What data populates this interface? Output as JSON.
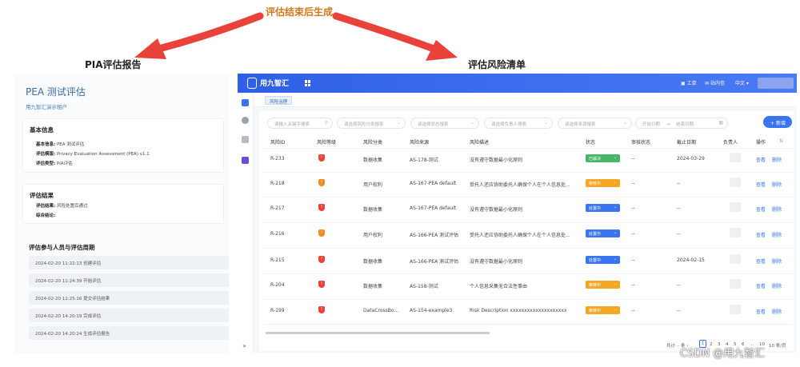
{
  "annotation": {
    "top_label": "评估结束后生成",
    "left_heading": "PIA评估报告",
    "right_heading": "评估风险清单"
  },
  "report": {
    "title": "PEA 测试评估",
    "tenant": "用九智汇演示租户",
    "basic_info": {
      "title": "基本信息",
      "name_label": "基本信息:",
      "name_value": "PEA 测试评估",
      "template_label": "评估模版:",
      "template_value": "Privacy Evaluation Assessment (PEA) v1.1",
      "type_label": "评估类型:",
      "type_value": "PIA评估"
    },
    "result": {
      "title": "评估结果",
      "result_label": "评估结果:",
      "result_value": "风险处置后通过",
      "conclusion_label": "综合结论:",
      "conclusion_value": ""
    },
    "timeline_title": "评估参与人员与评估周期",
    "timeline": [
      "2024-02-20 11:22:13 创建评估",
      "2024-02-20 11:24:39 开始评估",
      "2024-02-20 11:25:16 提交评估结果",
      "2024-02-20 14:20:19 完成评估",
      "2024-02-20 14:20:24 生成评估报告"
    ]
  },
  "app": {
    "logo": "用九智汇",
    "topbar_items": [
      "工单",
      "站内信",
      "中文"
    ],
    "tab": "风险治理",
    "filters": {
      "keyword": "请输入关键字搜索",
      "category": "请选择风险分类搜索",
      "status": "请选择状态搜索",
      "owner": "请选择负责人搜索",
      "source": "请选择来源搜索",
      "start_date": "开始日期",
      "arrow": "→",
      "end_date": "结束日期"
    },
    "add_button": "新增",
    "columns": [
      "风险ID",
      "风险等级",
      "风险分类",
      "风险来源",
      "风险描述",
      "状态",
      "审核状态",
      "截止日期",
      "负责人",
      "操作"
    ],
    "rows": [
      {
        "id": "R-233",
        "category": "数据收集",
        "source": "AS-178-测试",
        "desc": "没有遵守数据最小化原则",
        "status": "已解决",
        "review": "--",
        "due": "2024-03-29"
      },
      {
        "id": "R-218",
        "category": "用户权利",
        "source": "AS-167-PEA default",
        "desc": "受托人还应协助委托人确保个人在个人信息处...",
        "status": "审核中",
        "review": "--",
        "due": "--"
      },
      {
        "id": "R-217",
        "category": "数据收集",
        "source": "AS-167-PEA default",
        "desc": "没有遵守数据最小化原则",
        "status": "处置中",
        "review": "--",
        "due": "--"
      },
      {
        "id": "R-216",
        "category": "用户权利",
        "source": "AS-166-PEA 测试评估",
        "desc": "受托人还应协助委托人确保个人在个人信息处...",
        "status": "处置中",
        "review": "--",
        "due": "--"
      },
      {
        "id": "R-215",
        "category": "数据收集",
        "source": "AS-166-PEA 测试评估",
        "desc": "没有遵守数据最小化原则",
        "status": "处置中",
        "review": "--",
        "due": "2024-02-15"
      },
      {
        "id": "R-204",
        "category": "数据收集",
        "source": "AS-158-测试",
        "desc": "个人信息采集无合法性事由",
        "status": "审核中",
        "review": "--",
        "due": "--"
      },
      {
        "id": "R-199",
        "category": "DataCrossBo...",
        "source": "AS-154-example3",
        "desc": "Risk Description xxxxxxxxxxxxxxxxxxxx",
        "status": "审核中",
        "review": "--",
        "due": "--"
      }
    ],
    "actions": {
      "view": "查看",
      "delete": "删除"
    },
    "pager": {
      "total_prefix": "共计",
      "total_suffix": "条",
      "pages": [
        "1",
        "2",
        "3",
        "4",
        "5",
        "6",
        "...",
        "10"
      ],
      "per_page": "10 条/页"
    }
  },
  "watermark": "CSDN @用九智汇",
  "colors": {
    "accent": "#3a74f0",
    "arrow": "#e8423a",
    "level_high": "#e8423a",
    "level_mid": "#f08a24",
    "status_resolved": "#47b66b",
    "status_review": "#f5a623",
    "status_handling": "#3a74f0"
  }
}
